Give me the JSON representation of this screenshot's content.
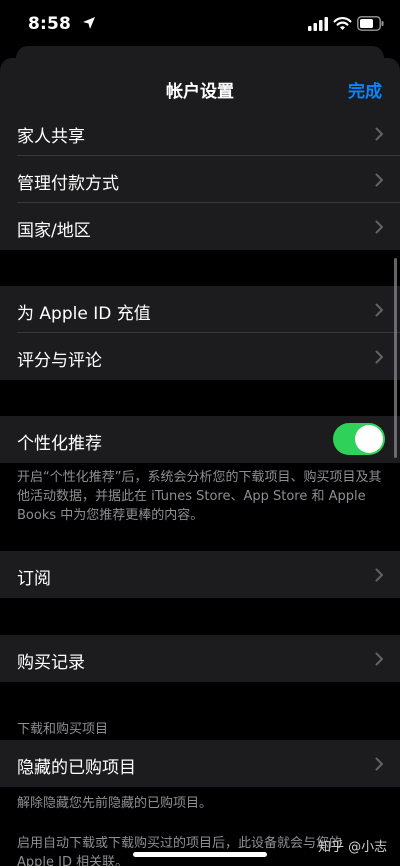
{
  "status_bar": {
    "time": "8:58"
  },
  "nav": {
    "title": "帐户设置",
    "done_label": "完成"
  },
  "section1": {
    "items": [
      "家人共享",
      "管理付款方式",
      "国家/地区"
    ]
  },
  "section2": {
    "items": [
      "为 Apple ID 充值",
      "评分与评论"
    ]
  },
  "personalization": {
    "label": "个性化推荐",
    "enabled": true,
    "footer": "开启“个性化推荐”后，系统会分析您的下载项目、购买项目及其他活动数据，并据此在 iTunes Store、App Store 和 Apple Books 中为您推荐更棒的内容。"
  },
  "subscriptions": {
    "label": "订阅"
  },
  "purchase_history": {
    "label": "购买记录"
  },
  "downloads": {
    "header": "下载和购买项目",
    "hidden_label": "隐藏的已购项目",
    "hidden_footer": "解除隐藏您先前隐藏的已购项目。",
    "auto_footer": "启用自动下载或下载购买过的项目后，此设备就会与您的 Apple ID 相关联。"
  },
  "watermark": "知乎 @小志",
  "colors": {
    "accent": "#0a84ff",
    "toggle_on": "#30d158",
    "cell_bg": "#1c1c1e",
    "secondary_text": "#8e8e93"
  }
}
